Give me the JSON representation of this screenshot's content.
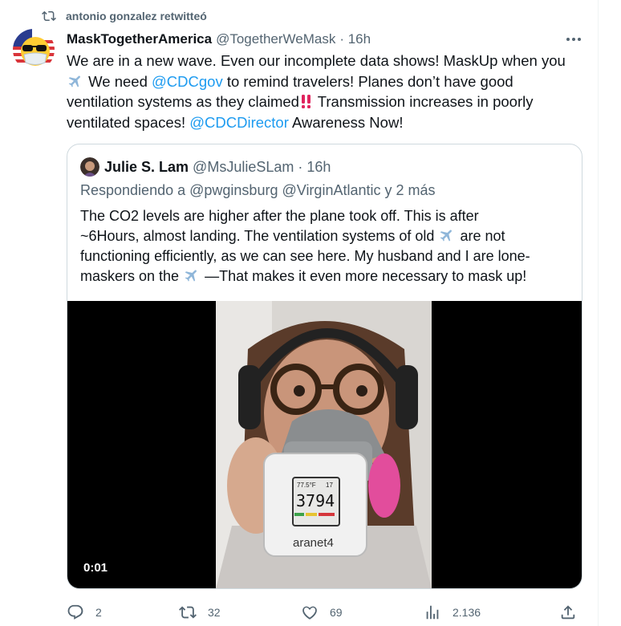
{
  "retweet": {
    "label": "antonio gonzalez retwitteó"
  },
  "tweet": {
    "name": "MaskTogetherAmerica",
    "handle": "@TogetherWeMask",
    "time": "· 16h",
    "lines": [
      {
        "t1": "We are in a new wave. Even our incomplete data shows! MaskUp when you"
      },
      {
        "t1": "We need",
        "m1": "@CDCgov",
        "t2": "to remind travelers! Planes don’t have good"
      },
      {
        "t1": "ventilation systems as they claimed"
      },
      {
        "t1": "Transmission increases in poorly"
      },
      {
        "t1": "ventilated spaces!",
        "m1": "@CDCDirector",
        "t2": "Awareness Now!"
      }
    ]
  },
  "quote": {
    "name": "Julie S. Lam",
    "handle": "@MsJulieSLam",
    "time": "· 16h",
    "reply_prefix": "Respondiendo a",
    "reply_to_1": "@pwginsburg",
    "reply_to_2": "@VirginAtlantic",
    "reply_suffix": "y 2 más",
    "lines": [
      "The CO2 levels are higher after the plane took off. This is after",
      "~6Hours, almost landing. The ventilation systems of old",
      "are not",
      "functioning efficiently, as we can see here. My husband and I are lone-",
      "maskers on the",
      "—That makes it even more necessary to mask up!"
    ],
    "video": {
      "timer": "0:01",
      "device_temp": "77.5°F",
      "device_humidity": "17",
      "device_co2": "3794",
      "device_brand": "aranet4"
    }
  },
  "actions": {
    "replies": "2",
    "retweets": "32",
    "likes": "69",
    "views": "2.136"
  },
  "colors": {
    "link": "#1d9bf0",
    "muted": "#536471",
    "text": "#0f1419",
    "border": "#cfd9de"
  },
  "icons": [
    "retweet-icon",
    "more-icon",
    "airplane-emoji-icon",
    "double-exclamation-emoji-icon",
    "reply-icon",
    "like-icon",
    "views-icon",
    "share-icon"
  ]
}
